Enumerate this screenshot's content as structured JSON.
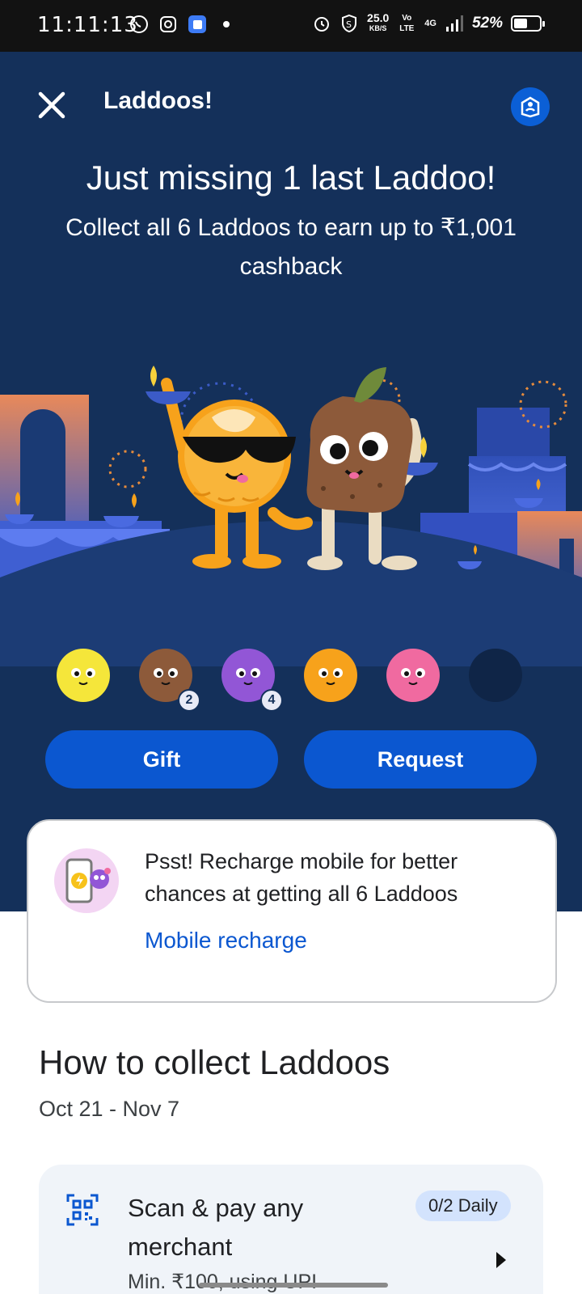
{
  "status_bar": {
    "time": "11:11:13",
    "net_speed": "25.0",
    "net_unit": "KB/S",
    "volte": "Vo LTE",
    "network": "4G",
    "battery": "52%",
    "battery_level": 0.52,
    "icons": [
      "whatsapp-icon",
      "instagram-icon",
      "app-icon",
      "dot-icon",
      "alarm-icon",
      "shield-icon",
      "signal-icon",
      "battery-icon"
    ]
  },
  "header": {
    "title": "Laddoos!",
    "close_icon": "close-icon",
    "guide_icon": "guide-icon"
  },
  "hero": {
    "headline": "Just missing 1 last Laddoo!",
    "subline": "Collect all 6 Laddoos to earn up to ₹1,001 cashback"
  },
  "laddoos": [
    {
      "name": "yellow-laddoo",
      "count": null,
      "collected": true,
      "color": "#f5e63a"
    },
    {
      "name": "brown-laddoo",
      "count": "2",
      "collected": true,
      "color": "#8d5a3a"
    },
    {
      "name": "purple-laddoo",
      "count": "4",
      "collected": true,
      "color": "#9256d6"
    },
    {
      "name": "sunglasses-laddoo",
      "count": null,
      "collected": true,
      "color": "#f7a21b"
    },
    {
      "name": "pink-laddoo",
      "count": null,
      "collected": true,
      "color": "#f06aa0"
    },
    {
      "name": "missing-laddoo",
      "count": null,
      "collected": false,
      "color": "#0f2547"
    }
  ],
  "actions": {
    "gift_label": "Gift",
    "request_label": "Request"
  },
  "promo": {
    "text": "Psst! Recharge mobile for better chances at getting all 6 Laddoos",
    "link": "Mobile recharge"
  },
  "how_to": {
    "title": "How to collect Laddoos",
    "dates": "Oct 21 - Nov 7",
    "tasks": [
      {
        "title": "Scan & pay any merchant",
        "subtitle": "Min. ₹100, using UPI",
        "badge": "0/2 Daily",
        "icon": "qr-scan-icon"
      }
    ]
  },
  "colors": {
    "hero_bg": "#14305a",
    "primary_button": "#0b57d0",
    "link": "#0b57d0"
  }
}
